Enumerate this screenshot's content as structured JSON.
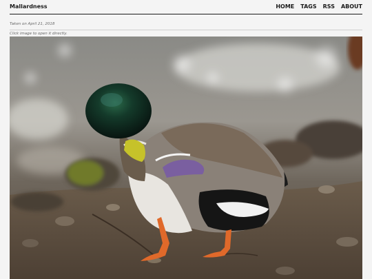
{
  "header": {
    "site_title": "Mallardness",
    "nav": [
      {
        "label": "HOME"
      },
      {
        "label": "TAGS"
      },
      {
        "label": "RSS"
      },
      {
        "label": "ABOUT"
      }
    ]
  },
  "post": {
    "taken_on": "Taken on April 21, 2018",
    "hint": "Click image to open it directly."
  },
  "photo": {
    "subject": "mallard-duck-preening"
  }
}
